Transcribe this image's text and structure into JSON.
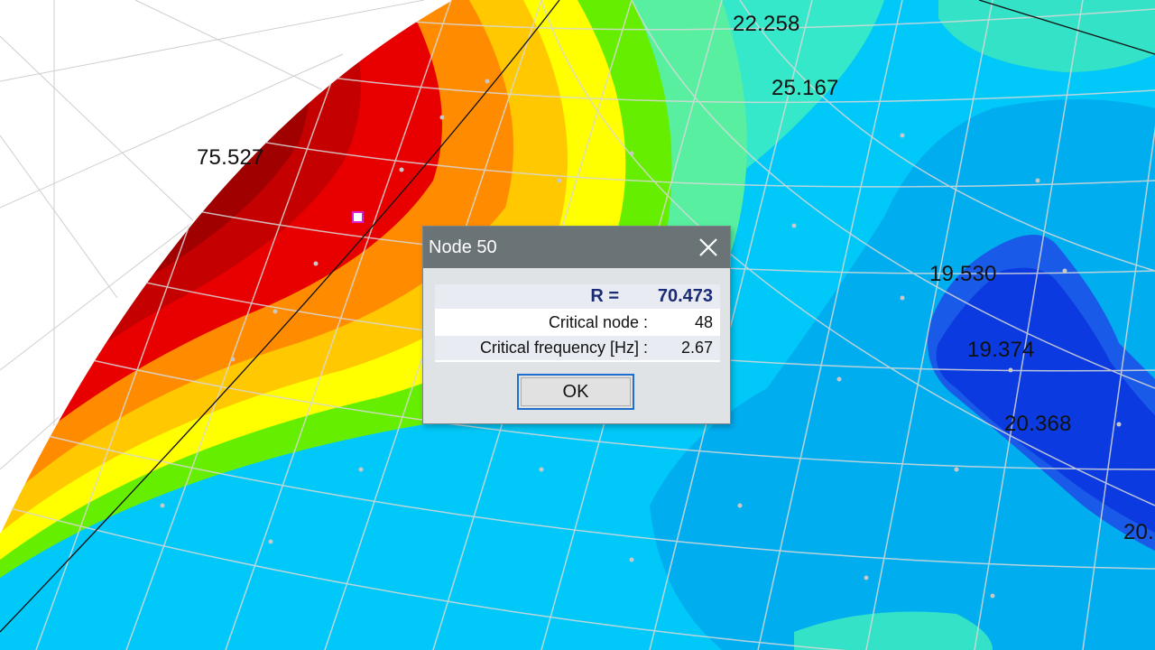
{
  "viewport": {
    "contour_labels": [
      "75.527",
      "22.258",
      "25.167",
      "19.530",
      "19.374",
      "20.368",
      "20."
    ]
  },
  "dialog": {
    "title": "Node 50",
    "close_icon": "close-icon",
    "result_label": "R =",
    "result_value": "70.473",
    "rows": [
      {
        "label": "Critical node :",
        "value": "48"
      },
      {
        "label": "Critical frequency [Hz] :",
        "value": "2.67"
      }
    ],
    "ok_label": "OK"
  },
  "colors": {
    "dialog_title_bar": "#6a7477",
    "dialog_body": "#dfe3e6",
    "result_text": "#1b2b76",
    "ok_focus_border": "#1f6fcf",
    "selected_node_marker": "#e020d0"
  }
}
